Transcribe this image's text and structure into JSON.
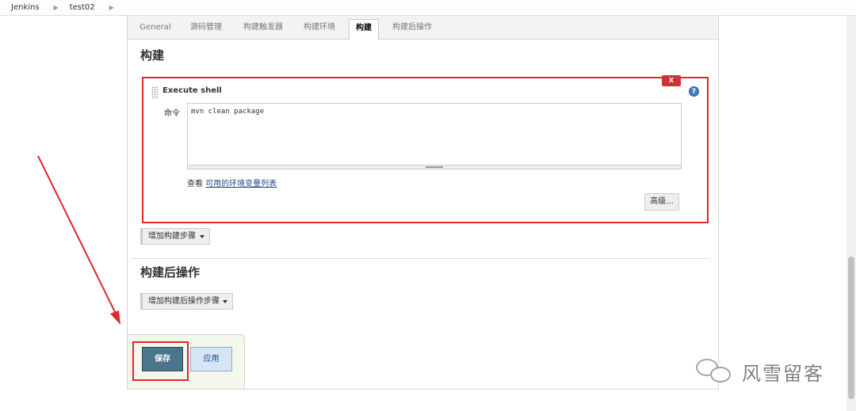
{
  "breadcrumbs": [
    "Jenkins",
    "test02"
  ],
  "tabs": [
    "General",
    "源码管理",
    "构建触发器",
    "构建环境",
    "构建",
    "构建后操作"
  ],
  "active_tab": "构建",
  "build_section": {
    "title": "构建",
    "step": {
      "title": "Execute shell",
      "delete_label": "X",
      "help_label": "?",
      "command_label": "命令",
      "command_value": "mvn clean package",
      "env_prefix": "查看",
      "env_link": "可用的环境变量列表",
      "advanced_button": "高级..."
    },
    "add_step_button": "增加构建步骤"
  },
  "post_build_section": {
    "title": "构建后操作",
    "add_step_button": "增加构建后操作步骤"
  },
  "buttons": {
    "save": "保存",
    "apply": "应用"
  },
  "watermark": "风雪留客",
  "colors": {
    "highlight": "#e0272a",
    "save_bg": "#4b758b",
    "apply_bg": "#d7e6f5",
    "link": "#204a87"
  }
}
